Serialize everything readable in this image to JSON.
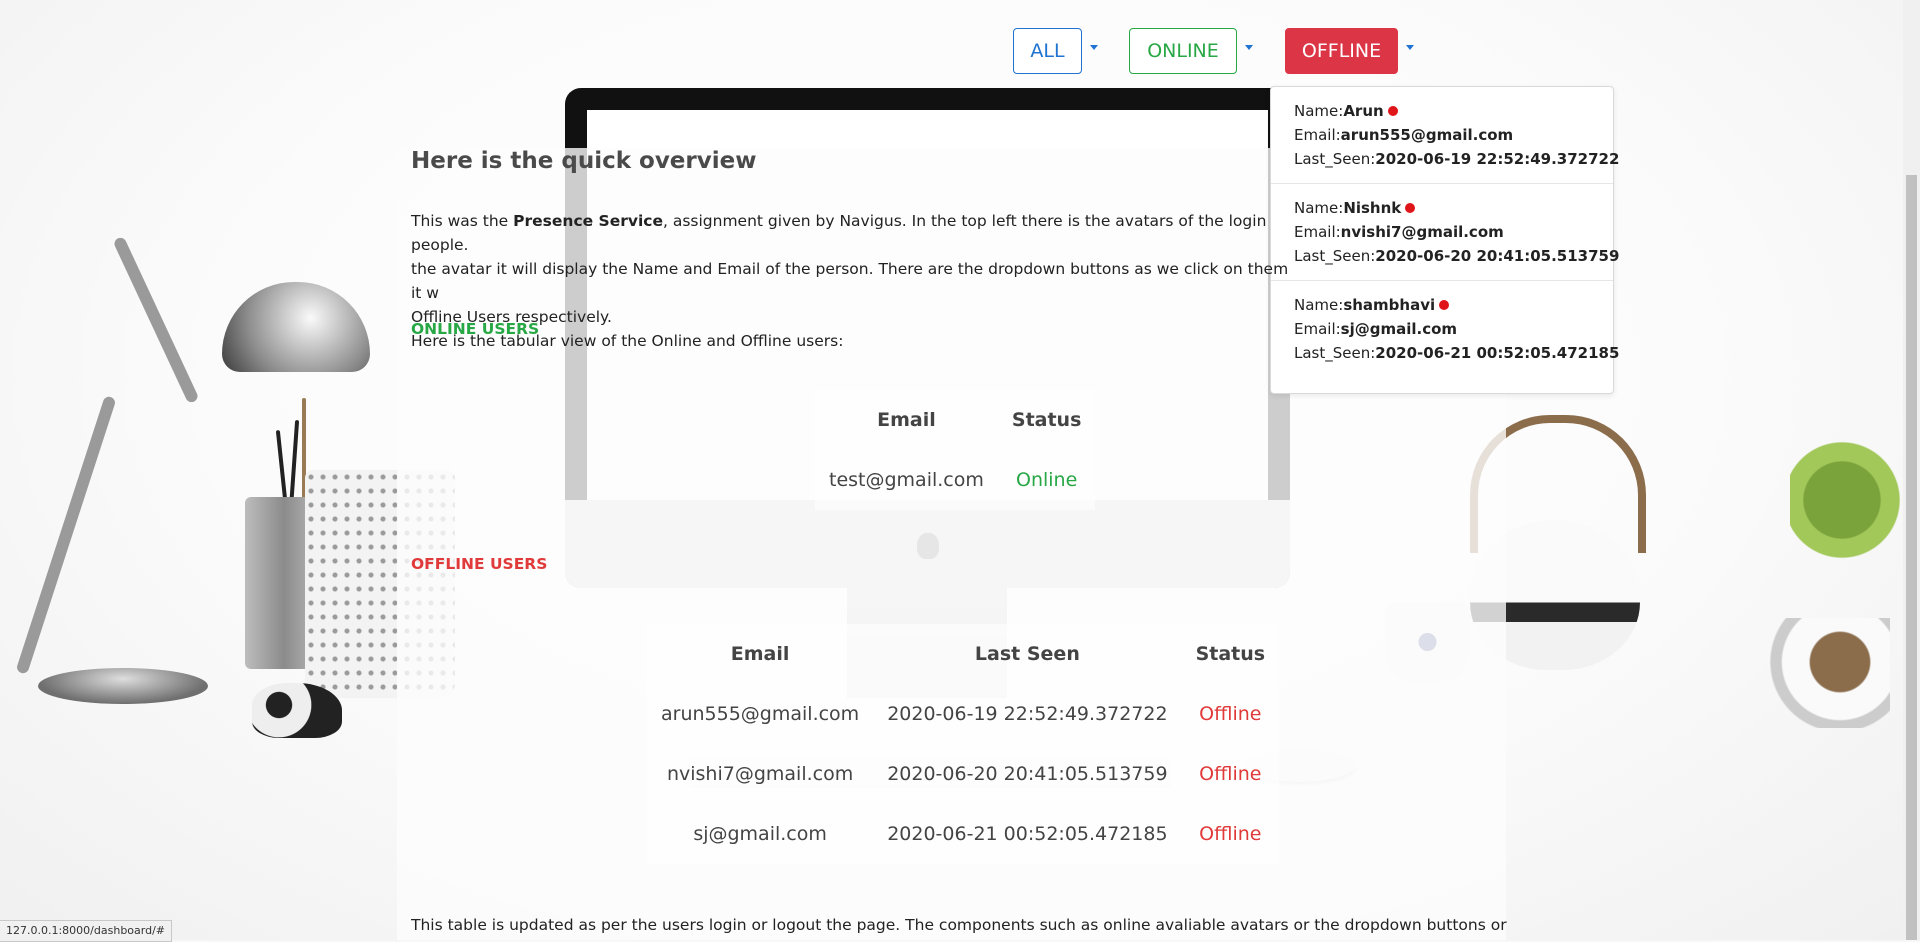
{
  "toolbar": {
    "all_label": "ALL",
    "online_label": "ONLINE",
    "offline_label": "OFFLINE"
  },
  "offline_menu": {
    "items": [
      {
        "name_prefix": "Name:",
        "name": "Arun",
        "email_prefix": "Email:",
        "email": "arun555@gmail.com",
        "last_seen_prefix": "Last_Seen:",
        "last_seen": "2020-06-19 22:52:49.372722"
      },
      {
        "name_prefix": "Name:",
        "name": "Nishnk",
        "email_prefix": "Email:",
        "email": "nvishi7@gmail.com",
        "last_seen_prefix": "Last_Seen:",
        "last_seen": "2020-06-20 20:41:05.513759"
      },
      {
        "name_prefix": "Name:",
        "name": "shambhavi",
        "email_prefix": "Email:",
        "email": "sj@gmail.com",
        "last_seen_prefix": "Last_Seen:",
        "last_seen": "2020-06-21 00:52:05.472185"
      }
    ]
  },
  "overview": {
    "heading": "Here is the quick overview",
    "p1_before": "This was the ",
    "p1_bold": "Presence Service",
    "p1_after": ", assignment given by Navigus. In the top left there is the avatars of the login people.",
    "p2": "the avatar it will display the Name and Email of the person. There are the dropdown buttons as we click on them it w",
    "p3": "Offline Users respectively.",
    "p4": "Here is the tabular view of the Online and Offline users:"
  },
  "online_section": {
    "title": "ONLINE USERS",
    "headers": [
      "Email",
      "Status"
    ],
    "rows": [
      {
        "email": "test@gmail.com",
        "status": "Online"
      }
    ]
  },
  "offline_section": {
    "title": "OFFLINE USERS",
    "headers": [
      "Email",
      "Last Seen",
      "Status"
    ],
    "rows": [
      {
        "email": "arun555@gmail.com",
        "last_seen": "2020-06-19 22:52:49.372722",
        "status": "Offline"
      },
      {
        "email": "nvishi7@gmail.com",
        "last_seen": "2020-06-20 20:41:05.513759",
        "status": "Offline"
      },
      {
        "email": "sj@gmail.com",
        "last_seen": "2020-06-21 00:52:05.472185",
        "status": "Offline"
      }
    ]
  },
  "footer": {
    "text": "This table is updated as per the users login or logout the page. The components such as online avaliable avatars or the dropdown buttons or the"
  },
  "statusbar": {
    "url": "127.0.0.1:8000/dashboard/#"
  },
  "colors": {
    "primary": "#1f73d1",
    "success": "#28a745",
    "danger": "#dc3545",
    "offline_dot": "#e0151a"
  },
  "icons": [
    "caret-down-icon",
    "red-dot-icon",
    "apple-logo-icon"
  ]
}
